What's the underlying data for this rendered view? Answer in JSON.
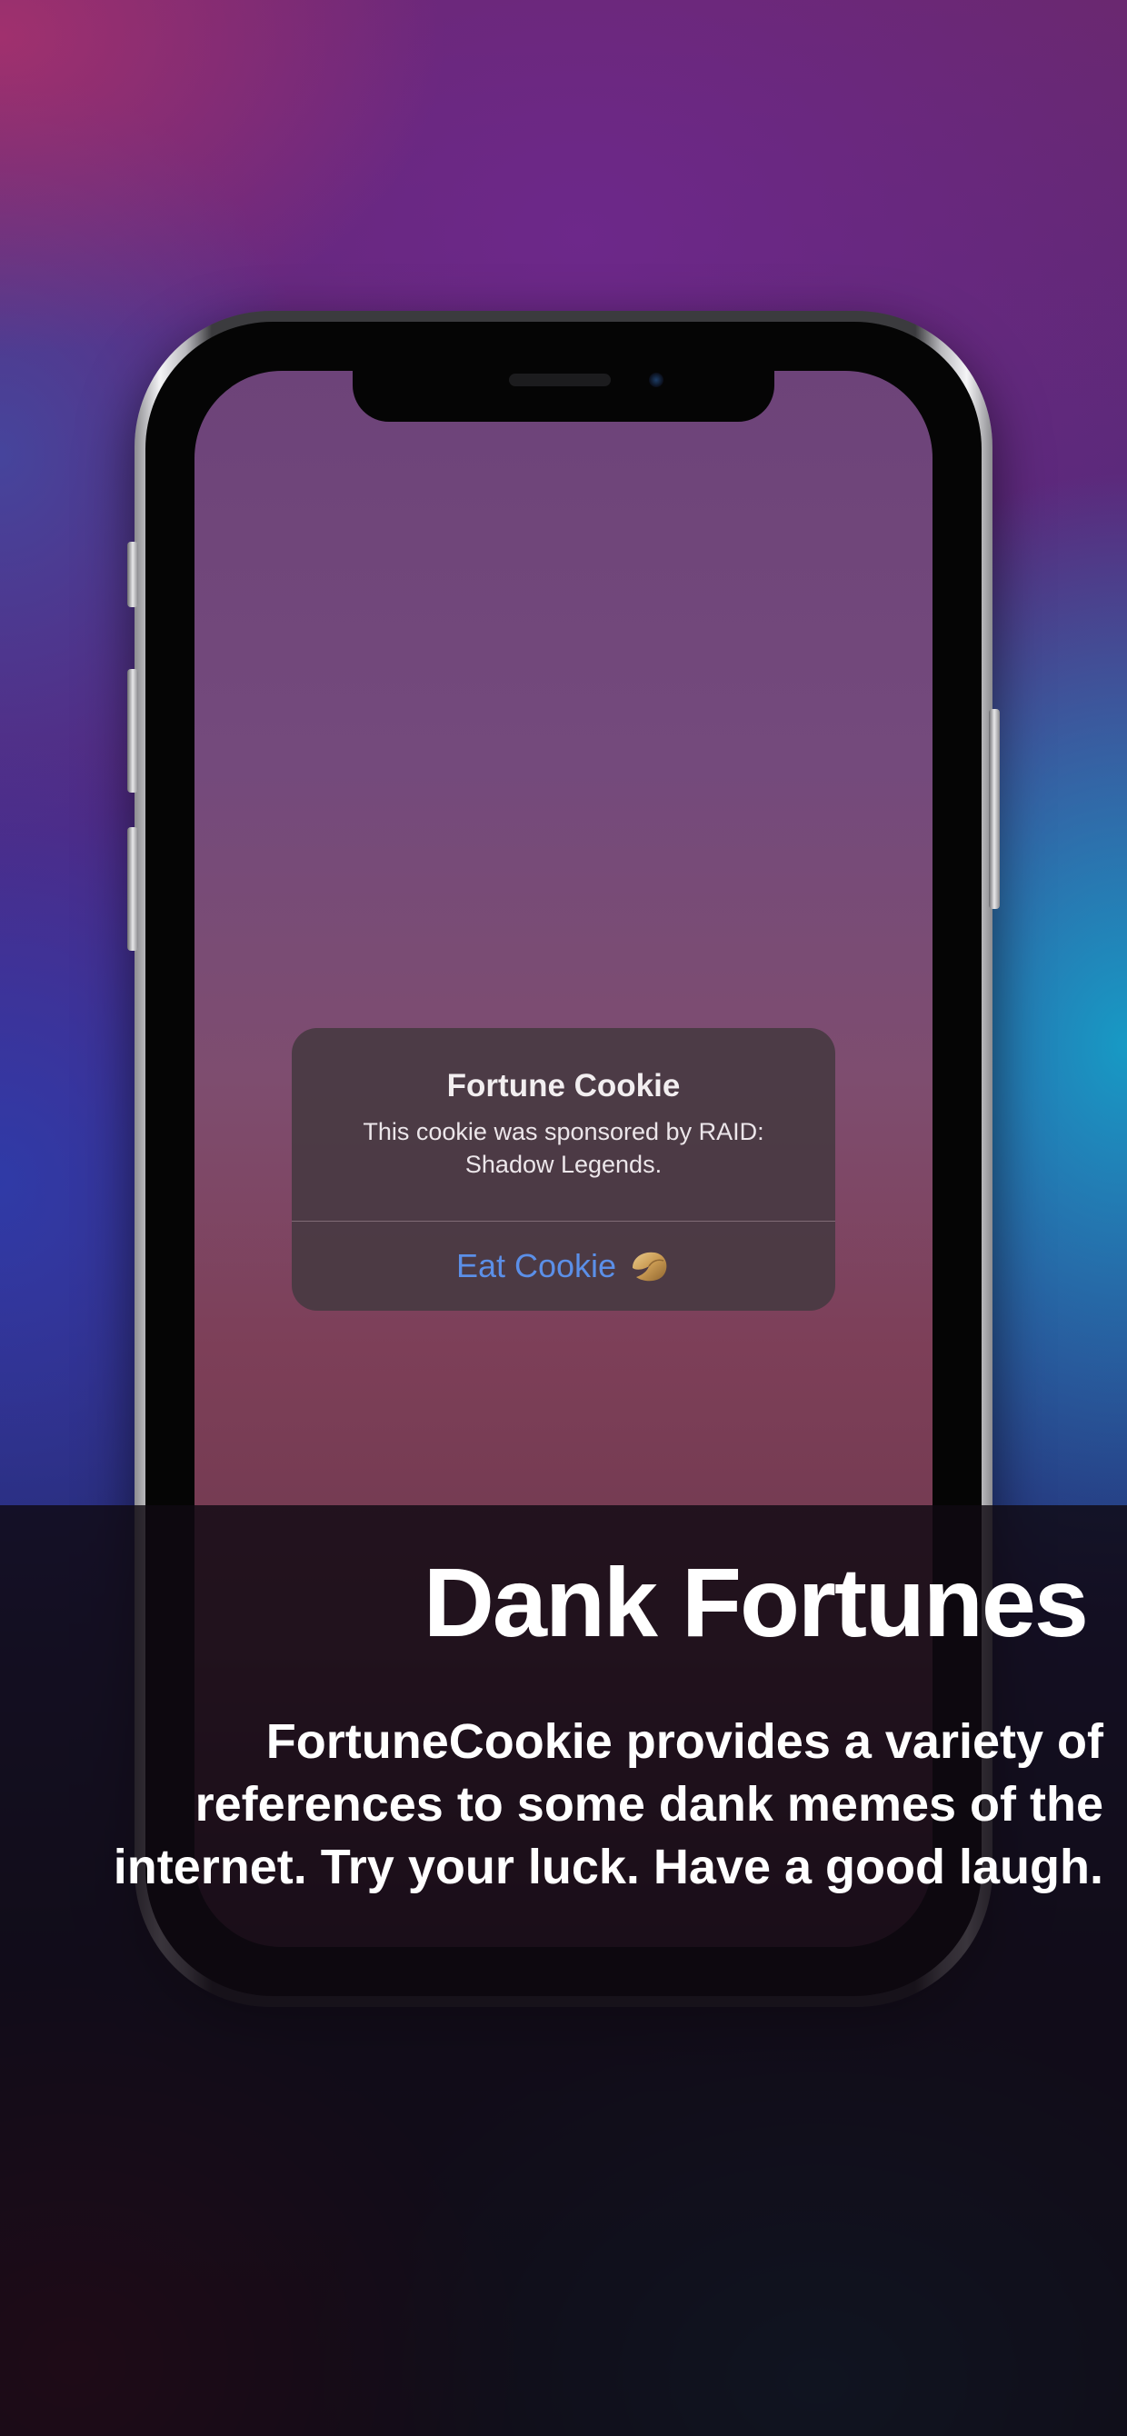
{
  "alert": {
    "title": "Fortune Cookie",
    "message": "This cookie was sponsored by RAID: Shadow Legends.",
    "action_label": "Eat Cookie",
    "action_icon": "fortune-cookie-icon",
    "action_color": "#5b8fe8"
  },
  "caption": {
    "headline": "Dank Fortunes",
    "body_lines": [
      "FortuneCookie provides a variety of",
      "references to some dank memes of the",
      "internet. Try your luck. Have a good laugh."
    ]
  }
}
